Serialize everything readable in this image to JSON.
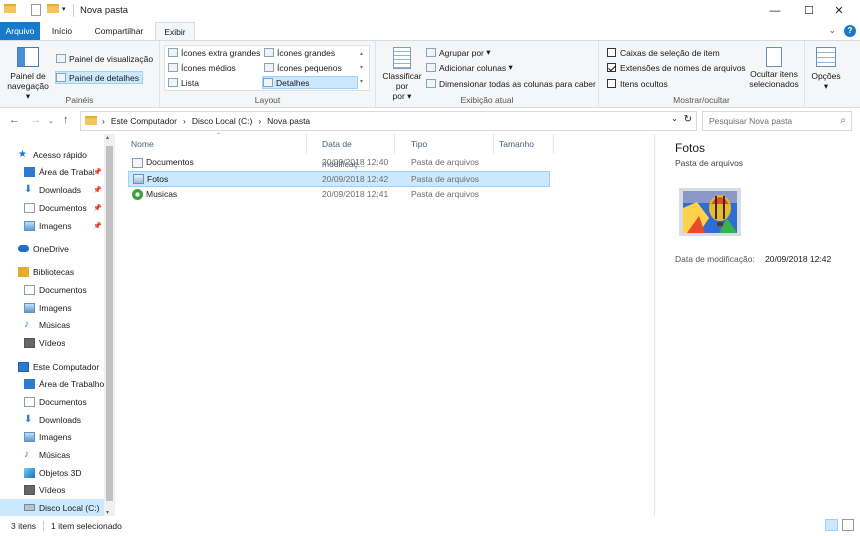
{
  "window": {
    "title": "Nova pasta",
    "controls": [
      "minimize",
      "maximize",
      "close"
    ]
  },
  "tabs": [
    {
      "label": "Arquivo",
      "kind": "file"
    },
    {
      "label": "Início"
    },
    {
      "label": "Compartilhar"
    },
    {
      "label": "Exibir",
      "active": true
    }
  ],
  "ribbon": {
    "paineis": {
      "label": "Painéis",
      "nav_pane": "Painel de navegação",
      "preview_pane": "Painel de visualização",
      "details_pane": "Painel de detalhes"
    },
    "layout": {
      "label": "Layout",
      "options": [
        "Ícones extra grandes",
        "Ícones grandes",
        "Ícones médios",
        "Ícones pequenos",
        "Lista",
        "Detalhes"
      ],
      "selected": "Detalhes"
    },
    "exibicao": {
      "label": "Exibição atual",
      "sort_by": "Classificar por",
      "group_by": "Agrupar por",
      "add_columns": "Adicionar colunas",
      "size_all_columns": "Dimensionar todas as colunas para caber"
    },
    "mostrar": {
      "label": "Mostrar/ocultar",
      "item_checkboxes": {
        "label": "Caixas de seleção de item",
        "checked": false
      },
      "file_extensions": {
        "label": "Extensões de nomes de arquivos",
        "checked": true
      },
      "hidden_items": {
        "label": "Itens ocultos",
        "checked": false
      },
      "hide_selected": "Ocultar itens selecionados"
    },
    "options": "Opções"
  },
  "address": {
    "path": [
      "Este Computador",
      "Disco Local (C:)",
      "Nova pasta"
    ],
    "search_placeholder": "Pesquisar Nova pasta"
  },
  "sidebar": {
    "items": [
      {
        "label": "Acesso rápido",
        "icon": "star-icon",
        "pinned": false
      },
      {
        "label": "Área de Trabalho",
        "icon": "desktop-icon",
        "pinned": true
      },
      {
        "label": "Downloads",
        "icon": "download-icon",
        "pinned": true
      },
      {
        "label": "Documentos",
        "icon": "document-icon",
        "pinned": true
      },
      {
        "label": "Imagens",
        "icon": "image-icon",
        "pinned": true
      },
      {
        "label": "OneDrive",
        "icon": "cloud-icon",
        "pinned": false
      },
      {
        "label": "Bibliotecas",
        "icon": "library-icon",
        "pinned": false
      },
      {
        "label": "Documentos",
        "icon": "document-icon",
        "pinned": false
      },
      {
        "label": "Imagens",
        "icon": "image-icon",
        "pinned": false
      },
      {
        "label": "Músicas",
        "icon": "music-icon",
        "pinned": false
      },
      {
        "label": "Vídeos",
        "icon": "video-icon",
        "pinned": false
      },
      {
        "label": "Este Computador",
        "icon": "computer-icon",
        "pinned": false
      },
      {
        "label": "Área de Trabalho",
        "icon": "desktop-icon",
        "pinned": false
      },
      {
        "label": "Documentos",
        "icon": "document-icon",
        "pinned": false
      },
      {
        "label": "Downloads",
        "icon": "download-icon",
        "pinned": false
      },
      {
        "label": "Imagens",
        "icon": "image-icon",
        "pinned": false
      },
      {
        "label": "Músicas",
        "icon": "music-icon",
        "pinned": false
      },
      {
        "label": "Objetos 3D",
        "icon": "cube-icon",
        "pinned": false
      },
      {
        "label": "Vídeos",
        "icon": "video-icon",
        "pinned": false
      },
      {
        "label": "Disco Local (C:)",
        "icon": "drive-icon",
        "pinned": false,
        "selected": true
      }
    ]
  },
  "columns": [
    "Nome",
    "Data de modificaç...",
    "Tipo",
    "Tamanho"
  ],
  "files": [
    {
      "name": "Documentos",
      "date": "20/09/2018 12:40",
      "type": "Pasta de arquivos",
      "icon": "document-folder-icon"
    },
    {
      "name": "Fotos",
      "date": "20/09/2018 12:42",
      "type": "Pasta de arquivos",
      "icon": "photo-folder-icon",
      "selected": true
    },
    {
      "name": "Musicas",
      "date": "20/09/2018 12:41",
      "type": "Pasta de arquivos",
      "icon": "music-folder-icon"
    }
  ],
  "preview": {
    "title": "Fotos",
    "subtitle": "Pasta de arquivos",
    "date_label": "Data de modificação:",
    "date_value": "20/09/2018 12:42"
  },
  "status": {
    "items_count": "3 itens",
    "selected_count": "1 item selecionado"
  },
  "colors": {
    "accent": "#1979ca",
    "selection": "#cce8ff",
    "selection_border": "#99d1ff"
  }
}
